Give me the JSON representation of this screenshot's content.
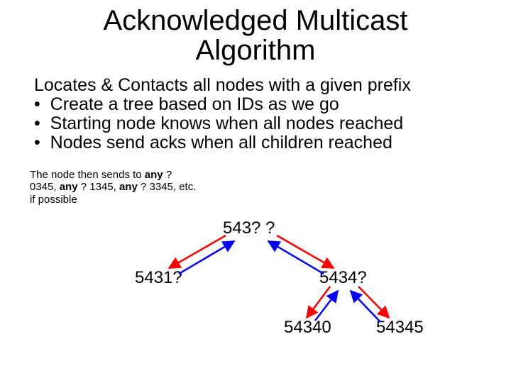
{
  "title_line1": "Acknowledged Multicast",
  "title_line2": "Algorithm",
  "subtitle": "Locates & Contacts all nodes with a given prefix",
  "bullets": [
    "Create a tree based on IDs as we go",
    "Starting node knows when all nodes reached",
    "Nodes send acks when all children reached"
  ],
  "note": {
    "pre1": "The node then sends to ",
    "b1": "any",
    "mid1": " ? 0345, ",
    "b2": "any",
    "mid2": " ? 1345, ",
    "b3": "any",
    "mid3": " ? 3345, etc. if possible"
  },
  "tree": {
    "root": "543? ?",
    "left": "5431?",
    "right": "5434?",
    "gc1": "54340",
    "gc2": "54345"
  },
  "colors": {
    "down": "#ff0000",
    "up": "#0000ff"
  }
}
